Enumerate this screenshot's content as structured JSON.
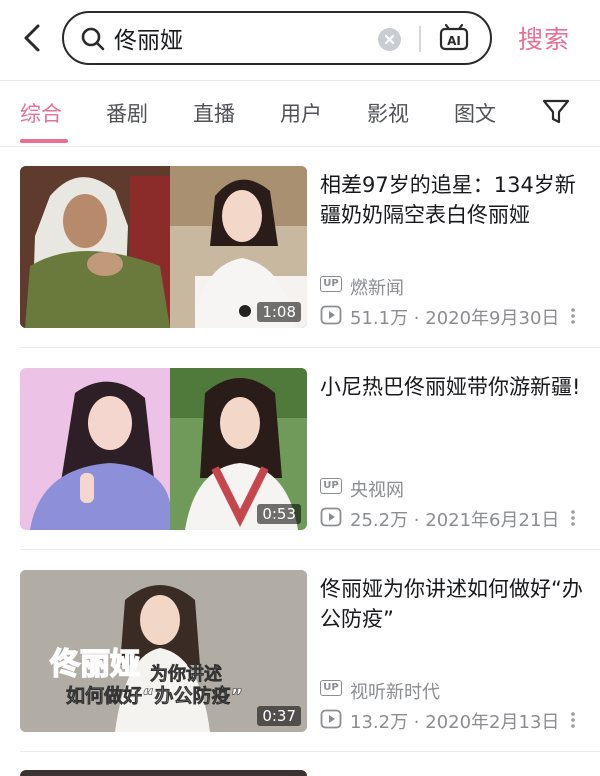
{
  "search": {
    "query": "佟丽娅",
    "button_label": "搜索",
    "ai_label": "AI"
  },
  "tabs": [
    {
      "label": "综合",
      "active": true
    },
    {
      "label": "番剧",
      "active": false
    },
    {
      "label": "直播",
      "active": false
    },
    {
      "label": "用户",
      "active": false
    },
    {
      "label": "影视",
      "active": false
    },
    {
      "label": "图文",
      "active": false
    }
  ],
  "results": [
    {
      "title": "相差97岁的追星：134岁新疆奶奶隔空表白佟丽娅",
      "uploader": "燃新闻",
      "views": "51.1万",
      "date": "2020年9月30日",
      "duration": "1:08"
    },
    {
      "title": "小尼热巴佟丽娅带你游新疆!",
      "uploader": "央视网",
      "views": "25.2万",
      "date": "2021年6月21日",
      "duration": "0:53"
    },
    {
      "title": "佟丽娅为你讲述如何做好“办公防疫”",
      "uploader": "视听新时代",
      "views": "13.2万",
      "date": "2020年2月13日",
      "duration": "0:37",
      "caption_name": "佟丽娅",
      "caption_line1": "为你讲述",
      "caption_line2": "如何做好“办公防疫”"
    }
  ],
  "badge": "UP",
  "colors": {
    "accent": "#e96f95",
    "text": "#18191c",
    "meta": "#8b8d91"
  },
  "icons": [
    "back-arrow-icon",
    "search-icon",
    "clear-icon",
    "ai-assistant-icon",
    "filter-icon",
    "up-badge-icon",
    "play-count-icon",
    "more-icon"
  ]
}
